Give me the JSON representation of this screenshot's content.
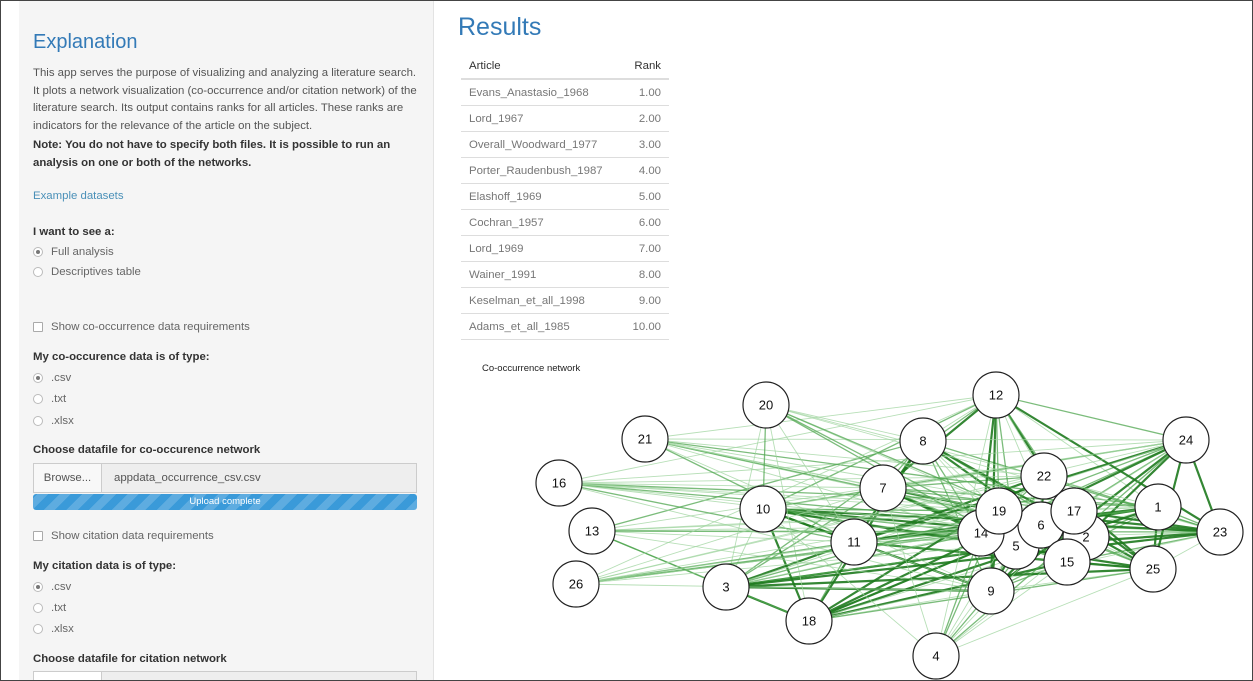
{
  "sidebar": {
    "explanation_title": "Explanation",
    "explanation_text": "This app serves the purpose of visualizing and analyzing a literature search. It plots a network visualization (co-occurrence and/or citation network) of the literature search. Its output contains ranks for all articles. These ranks are indicators for the relevance of the article on the subject.",
    "note_text": "Note: You do not have to specify both files. It is possible to run an analysis on one or both of the networks.",
    "example_link": "Example datasets",
    "analysis_label": "I want to see a:",
    "analysis_options": [
      {
        "label": "Full analysis",
        "selected": true
      },
      {
        "label": "Descriptives table",
        "selected": false
      }
    ],
    "cooc_requirements_label": "Show co-occurrence data requirements",
    "cooc_type_label": "My co-occurence data is of type:",
    "cooc_type_options": [
      {
        "label": ".csv",
        "selected": true
      },
      {
        "label": ".txt",
        "selected": false
      },
      {
        "label": ".xlsx",
        "selected": false
      }
    ],
    "cooc_file_label": "Choose datafile for co-occurence network",
    "cooc_browse_label": "Browse...",
    "cooc_file_name": "appdata_occurrence_csv.csv",
    "cooc_upload_status": "Upload complete",
    "cooc_upload_progress": 1.0,
    "citation_requirements_label": "Show citation data requirements",
    "citation_type_label": "My citation data is of type:",
    "citation_type_options": [
      {
        "label": ".csv",
        "selected": true
      },
      {
        "label": ".txt",
        "selected": false
      },
      {
        "label": ".xlsx",
        "selected": false
      }
    ],
    "citation_file_label": "Choose datafile for citation network"
  },
  "results": {
    "title": "Results",
    "columns": [
      "Article",
      "Rank"
    ],
    "rows": [
      [
        "Evans_Anastasio_1968",
        "1.00"
      ],
      [
        "Lord_1967",
        "2.00"
      ],
      [
        "Overall_Woodward_1977",
        "3.00"
      ],
      [
        "Porter_Raudenbush_1987",
        "4.00"
      ],
      [
        "Elashoff_1969",
        "5.00"
      ],
      [
        "Cochran_1957",
        "6.00"
      ],
      [
        "Lord_1969",
        "7.00"
      ],
      [
        "Wainer_1991",
        "8.00"
      ],
      [
        "Keselman_et_all_1998",
        "9.00"
      ],
      [
        "Adams_et_all_1985",
        "10.00"
      ]
    ]
  },
  "network": {
    "title": "Co-occurrence network",
    "edge_colors": [
      "#1e7a1e",
      "#4fa64f",
      "#9fd49f"
    ],
    "node_labels": [
      "1",
      "2",
      "3",
      "4",
      "5",
      "6",
      "7",
      "8",
      "9",
      "10",
      "11",
      "12",
      "13",
      "14",
      "15",
      "16",
      "17",
      "18",
      "19",
      "20",
      "21",
      "22",
      "23",
      "24",
      "25",
      "26"
    ]
  }
}
